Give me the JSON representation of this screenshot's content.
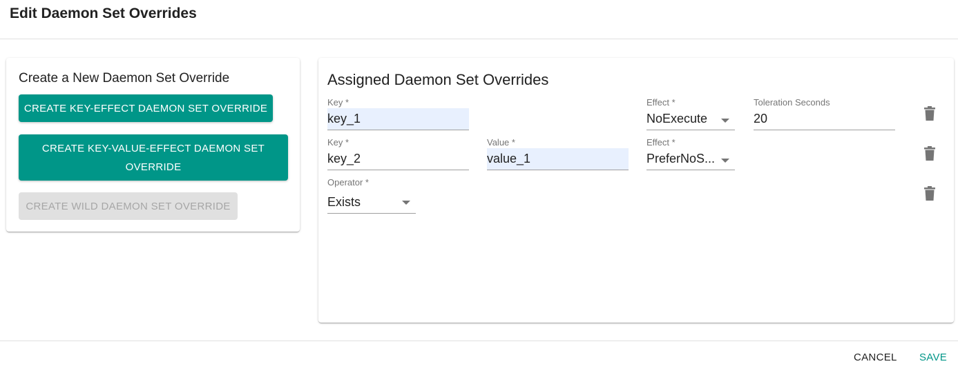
{
  "dialog": {
    "title": "Edit Daemon Set Overrides",
    "cancel_label": "CANCEL",
    "save_label": "SAVE"
  },
  "create_panel": {
    "title": "Create a New Daemon Set Override",
    "buttons": [
      {
        "label": "CREATE KEY-EFFECT DAEMON SET OVERRIDE",
        "enabled": true
      },
      {
        "label": "CREATE KEY-VALUE-EFFECT DAEMON SET OVERRIDE",
        "enabled": true
      },
      {
        "label": "CREATE WILD DAEMON SET OVERRIDE",
        "enabled": false
      }
    ]
  },
  "assigned_panel": {
    "title": "Assigned Daemon Set Overrides",
    "overrides": [
      {
        "key": {
          "label": "Key *",
          "value": "key_1"
        },
        "effect": {
          "label": "Effect *",
          "value": "NoExecute"
        },
        "toleration": {
          "label": "Toleration Seconds",
          "value": "20"
        },
        "delete_icon": "trash-icon"
      },
      {
        "key": {
          "label": "Key *",
          "value": "key_2"
        },
        "value": {
          "label": "Value *",
          "value": "value_1"
        },
        "effect": {
          "label": "Effect *",
          "value": "PreferNoS..."
        },
        "delete_icon": "trash-icon"
      },
      {
        "operator": {
          "label": "Operator *",
          "value": "Exists"
        },
        "delete_icon": "trash-icon"
      }
    ]
  },
  "colors": {
    "primary": "#009688",
    "autofill_bg": "#e8f0fe",
    "disabled_bg": "#e0e0e0"
  }
}
